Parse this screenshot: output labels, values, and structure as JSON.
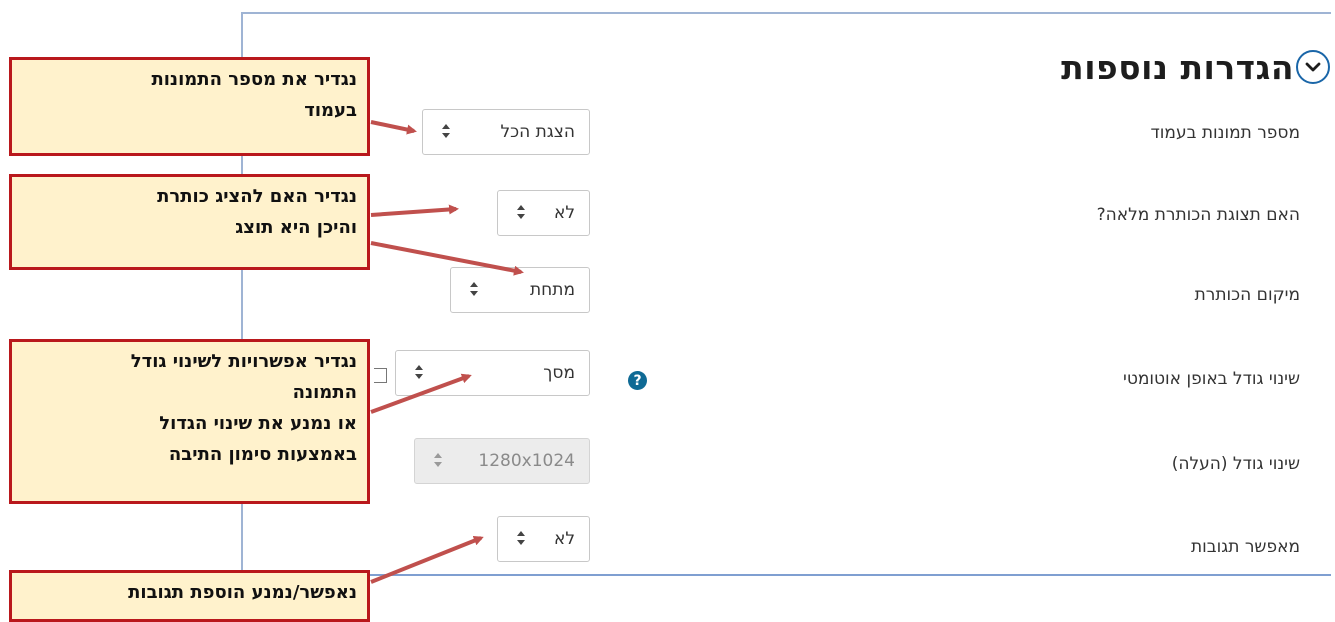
{
  "section": {
    "title": "הגדרות נוספות",
    "collapse_icon": "chevron-down-icon"
  },
  "fields": [
    {
      "label": "מספר תמונות בעמוד",
      "value": "הצגת הכל"
    },
    {
      "label": "האם תצוגת הכותרת מלאה?",
      "value": "לא"
    },
    {
      "label": "מיקום הכותרת",
      "value": "מתחת"
    },
    {
      "label": "שינוי גודל באופן אוטומטי",
      "value": "מסך"
    },
    {
      "label": "שינוי גודל (העלה)",
      "value": "1280x1024"
    },
    {
      "label": "מאפשר תגובות",
      "value": "לא"
    }
  ],
  "help_symbol": "?",
  "annotations": [
    {
      "lines": [
        "נגדיר את מספר התמונות",
        "בעמוד"
      ]
    },
    {
      "lines": [
        "נגדיר האם להציג כותרת",
        "והיכן היא תוצג"
      ]
    },
    {
      "lines": [
        "נגדיר אפשרויות לשינוי גודל",
        "התמונה",
        "או נמנע את שינוי הגדול",
        "באמצעות סימון התיבה"
      ]
    },
    {
      "lines": [
        "נאפשר/נמנע הוספת תגובות"
      ]
    }
  ],
  "colors": {
    "annotation_bg": "#fff2cc",
    "annotation_border": "#b9181c",
    "arrow": "#c0504d",
    "accent": "#1a66a8"
  }
}
